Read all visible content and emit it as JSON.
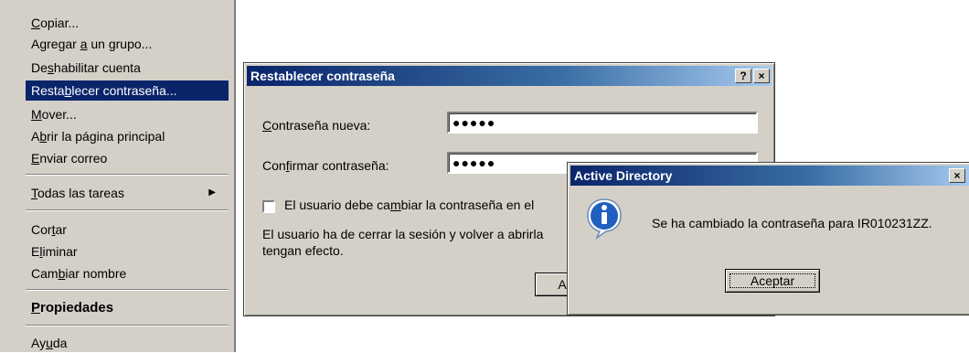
{
  "context_menu": {
    "items": [
      {
        "label": "Copiar...",
        "accel": "C"
      },
      {
        "label": "Agregar a un grupo...",
        "accel": "a"
      },
      {
        "label": "Deshabilitar cuenta",
        "accel": "s"
      },
      {
        "label": "Restablecer contraseña...",
        "accel": "b"
      },
      {
        "label": "Mover...",
        "accel": "M"
      },
      {
        "label": "Abrir la página principal",
        "accel": "b"
      },
      {
        "label": "Enviar correo",
        "accel": "E"
      },
      {
        "label": "Todas las tareas",
        "accel": "T"
      },
      {
        "label": "Cortar",
        "accel": "t"
      },
      {
        "label": "Eliminar",
        "accel": "l"
      },
      {
        "label": "Cambiar nombre",
        "accel": "b"
      },
      {
        "label": "Propiedades",
        "accel": "P"
      },
      {
        "label": "Ayuda",
        "accel": "u"
      }
    ]
  },
  "reset_dialog": {
    "title": "Restablecer contraseña",
    "help_btn": "?",
    "close_btn": "×",
    "new_password_label": "Contraseña nueva:",
    "new_password_value": "●●●●●",
    "confirm_password_label": "Confirmar contraseña:",
    "confirm_password_value": "●●●●●",
    "checkbox_label": "El usuario debe cambiar la contraseña en el",
    "info_line1": "El usuario ha de cerrar la sesión y volver a abrirla",
    "info_line2": "tengan efecto.",
    "accept_partial": "A"
  },
  "ad_dialog": {
    "title": "Active Directory",
    "close_btn": "×",
    "message": "Se ha cambiado la contraseña para IR010231ZZ.",
    "ok_label": "Aceptar"
  }
}
